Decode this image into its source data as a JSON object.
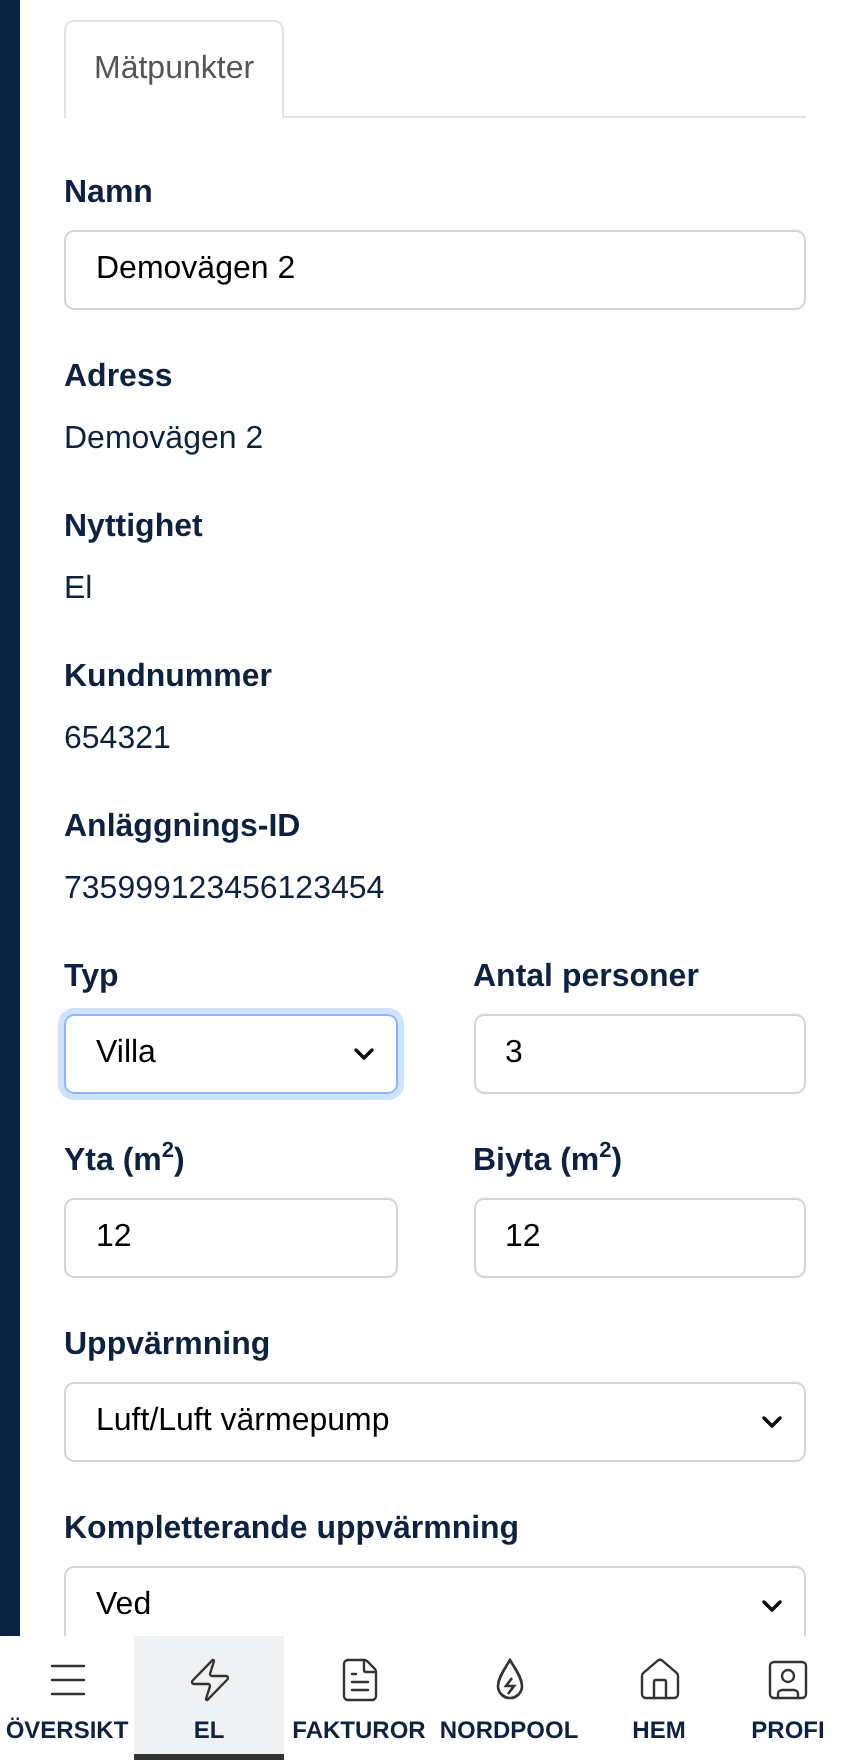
{
  "tabs": [
    {
      "label": "Mätpunkter",
      "selected": true
    }
  ],
  "rows": [
    [
      {
        "label": "Namn",
        "kind": "input",
        "value": "Demovägen 2",
        "focused": false
      }
    ],
    [
      {
        "label": "Adress",
        "kind": "text",
        "value": "Demovägen 2"
      }
    ],
    [
      {
        "label": "Nyttighet",
        "kind": "text",
        "value": "El"
      }
    ],
    [
      {
        "label": "Kundnummer",
        "kind": "text",
        "value": "654321"
      }
    ],
    [
      {
        "label": "Anläggnings-ID",
        "kind": "text",
        "value": "735999123456123454"
      }
    ],
    [
      {
        "label": "Typ",
        "kind": "select",
        "value": "Villa",
        "focused": true
      },
      {
        "label": "Antal personer",
        "kind": "input",
        "value": "3",
        "focused": false
      }
    ],
    [
      {
        "label": "Yta (m$^{2}$)",
        "kind": "input",
        "value": "12",
        "focused": false
      },
      {
        "label": "Biyta (m$^{2}$)",
        "kind": "input",
        "value": "12",
        "focused": false
      }
    ],
    [
      {
        "label": "Uppvärmning",
        "kind": "select",
        "value": "Luft/Luft värmepump",
        "focused": false
      }
    ],
    [
      {
        "label": "Kompletterande uppvärmning",
        "kind": "select",
        "value": "Ved",
        "focused": false
      }
    ]
  ],
  "nav": [
    {
      "label": "ÖVERSIKT",
      "selected": false
    },
    {
      "label": "EL",
      "selected": true
    },
    {
      "label": "FAKTUROR",
      "selected": false
    },
    {
      "label": "NORDPOOL",
      "selected": false
    },
    {
      "label": "HEM",
      "selected": false
    },
    {
      "label": "PROFI",
      "selected": false
    }
  ]
}
